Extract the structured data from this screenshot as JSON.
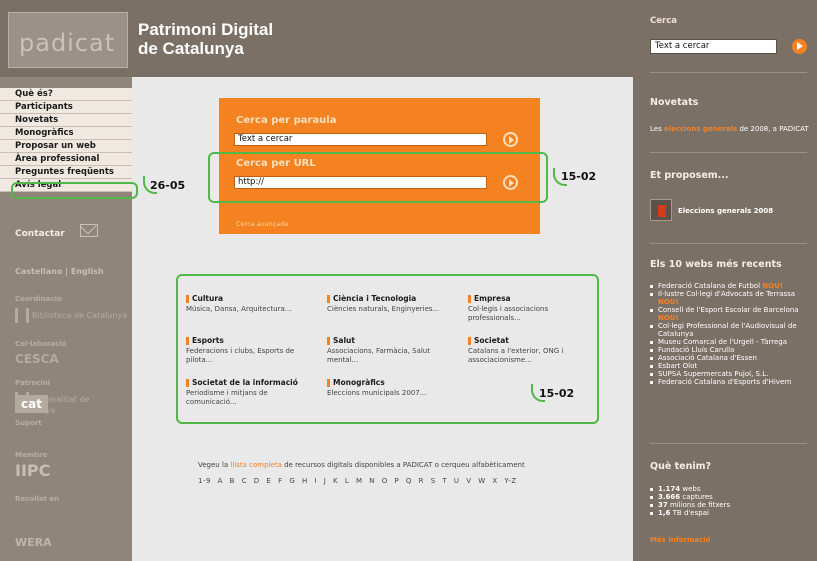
{
  "header": {
    "logo_text": "padicat",
    "title_line1": "Patrimoni Digital",
    "title_line2": "de Catalunya"
  },
  "nav": {
    "items": [
      "Què és?",
      "Participants",
      "Novetats",
      "Monogràfics",
      "Proposar un web",
      "Àrea professional",
      "Preguntes freqüents",
      "Avís legal"
    ],
    "contact": "Contactar",
    "languages": "Castellano | English"
  },
  "partners": {
    "coordination_label": "Coordinació",
    "coordination_logo": "Biblioteca de Catalunya",
    "collab_label": "Col·laboració",
    "collab_logo": "CESCA",
    "patron_label": "Patrocini",
    "patron_logo": "Generalitat de Catalunya",
    "support_label": "Suport",
    "support_logo": "cat",
    "member_label": "Membre",
    "member_logo": "IIPC",
    "harvest_label": "Recollat en",
    "harvest_logo": "WERA"
  },
  "search_panel": {
    "word_title": "Cerca per paraula",
    "word_value": "Text a cercar",
    "url_title": "Cerca per URL",
    "url_value": "http://",
    "advanced": "Cerca avançada"
  },
  "categories": [
    {
      "name": "Cultura",
      "desc": "Música, Dansa, Arquitectura..."
    },
    {
      "name": "Ciència i Tecnologia",
      "desc": "Ciències naturals, Enginyeries..."
    },
    {
      "name": "Empresa",
      "desc": "Col·legis i associacions professionals..."
    },
    {
      "name": "Esports",
      "desc": "Federacions i clubs, Esports de pilota..."
    },
    {
      "name": "Salut",
      "desc": "Associacions, Farmàcia, Salut mental..."
    },
    {
      "name": "Societat",
      "desc": "Catalans a l'exterior, ONG i associacionisme..."
    },
    {
      "name": "Societat de la informació",
      "desc": "Periodisme i mitjans de comunicació..."
    },
    {
      "name": "Monogràfics",
      "desc": "Eleccions municipals 2007..."
    }
  ],
  "browse": {
    "before": "Vegeu la",
    "link": "llista completa",
    "after": "de recursos digitals disponibles a PADICAT o cerqueu alfabèticament",
    "alphabet": "1-9 A B C D E F G H I J K L M N O P Q R S T U V W X Y-Z"
  },
  "right": {
    "cerca_label": "Cerca",
    "search_value": "Text a cercar",
    "novetats_title": "Novetats",
    "novetats_pre": "Les",
    "novetats_link": "eleccions generals",
    "novetats_post": "de 2008, a PADICAT",
    "proposem_title": "Et proposem...",
    "proposem_item": "Eleccions generals 2008",
    "recent_title": "Els 10 webs més recents",
    "recent": [
      {
        "text": "Federació Catalana de Futbol",
        "badge": "NOU!"
      },
      {
        "text": "Il·lustre Col·legi d'Advocats de Terrassa",
        "badge": "NOU!"
      },
      {
        "text": "Consell de l'Esport Escolar de Barcelona",
        "badge": "NOU!"
      },
      {
        "text": "Col·legi Professional de l'Audiovisual de Catalunya",
        "badge": ""
      },
      {
        "text": "Museu Comarcal de l'Urgell - Tàrrega",
        "badge": ""
      },
      {
        "text": "Fundació Lluís Carulla",
        "badge": ""
      },
      {
        "text": "Associació Catalana d'Essen",
        "badge": ""
      },
      {
        "text": "Esbart Olot",
        "badge": ""
      },
      {
        "text": "SUPSA Supermercats Pujol, S.L.",
        "badge": ""
      },
      {
        "text": "Federació Catalana d'Esports d'Hivern",
        "badge": ""
      }
    ],
    "tenim_title": "Què tenim?",
    "stats": [
      {
        "value": "1.174",
        "label": "webs"
      },
      {
        "value": "3.666",
        "label": "captures"
      },
      {
        "value": "37",
        "label": "milions de fitxers"
      },
      {
        "value": "1,6",
        "label": "TB d'espai"
      }
    ],
    "more": "Més informació"
  },
  "annotations": {
    "left_tag": "26-05",
    "url_tag": "15-02",
    "cats_tag": "15-02"
  },
  "colors": {
    "accent": "#f58221",
    "header_bg": "#7b7066",
    "annotation": "#51b848"
  }
}
